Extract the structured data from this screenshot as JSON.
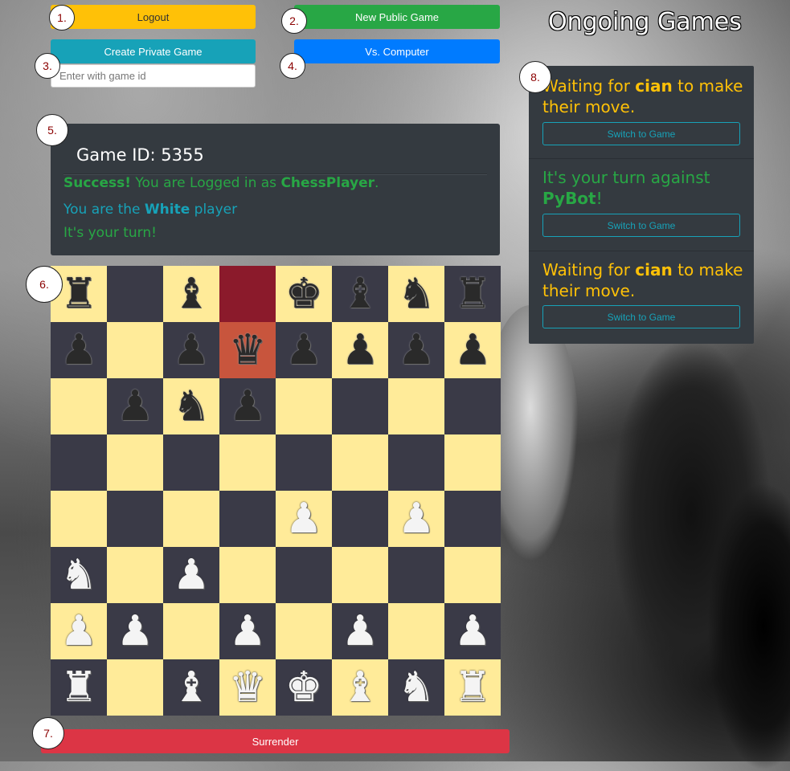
{
  "toolbar": {
    "logout_label": "Logout",
    "new_public_game_label": "New Public Game",
    "create_private_game_label": "Create Private Game",
    "vs_computer_label": "Vs. Computer",
    "game_id_placeholder": "Enter with game id",
    "surrender_label": "Surrender"
  },
  "colors": {
    "logout": "#ffc107",
    "new_public_game": "#28a745",
    "create_private_game": "#17a2b8",
    "vs_computer": "#007bff",
    "surrender": "#dc3545"
  },
  "markers": [
    "1.",
    "2.",
    "3.",
    "4.",
    "5.",
    "6.",
    "7.",
    "8."
  ],
  "info": {
    "game_id_text": "Game ID: 5355",
    "success_bold": "Success!",
    "success_text": " You are Logged in as ",
    "username": "ChessPlayer",
    "success_end": ".",
    "player_prefix": "You are the ",
    "player_color": "White",
    "player_suffix": " player",
    "turn_text": "It's your turn!"
  },
  "board": {
    "rows": [
      [
        "r",
        "",
        "b",
        "",
        "k",
        "b",
        "n",
        "r"
      ],
      [
        "p",
        "",
        "p",
        "q",
        "p",
        "p",
        "p",
        "p"
      ],
      [
        "",
        "p",
        "n",
        "p",
        "",
        "",
        "",
        ""
      ],
      [
        "",
        "",
        "",
        "",
        "",
        "",
        "",
        ""
      ],
      [
        "",
        "",
        "",
        "",
        "P",
        "",
        "P",
        ""
      ],
      [
        "N",
        "",
        "P",
        "",
        "",
        "",
        "",
        ""
      ],
      [
        "P",
        "P",
        "",
        "P",
        "",
        "P",
        "",
        "P"
      ],
      [
        "R",
        "",
        "B",
        "Q",
        "K",
        "B",
        "N",
        "R"
      ]
    ],
    "highlight_from": [
      0,
      3
    ],
    "highlight_to": [
      1,
      3
    ]
  },
  "ongoing": {
    "title": "Ongoing Games",
    "games": [
      {
        "prefix": "Waiting for ",
        "name": "cian",
        "suffix": " to make their move.",
        "color": "yellow",
        "button": "Switch to Game"
      },
      {
        "prefix": "It's your turn against ",
        "name": "PyBot",
        "suffix": "!",
        "color": "green",
        "button": "Switch to Game"
      },
      {
        "prefix": "Waiting for ",
        "name": "cian",
        "suffix": " to make their move.",
        "color": "yellow",
        "button": "Switch to Game"
      }
    ]
  }
}
